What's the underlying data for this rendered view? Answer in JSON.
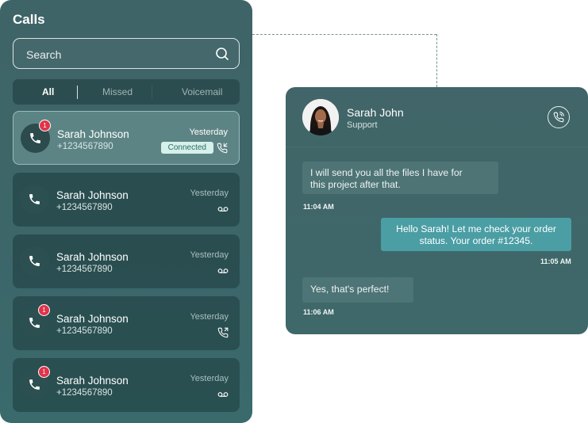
{
  "calls": {
    "title": "Calls",
    "search_placeholder": "Search",
    "tabs": [
      "All",
      "Missed",
      "Voicemail"
    ],
    "active_tab": "All",
    "items": [
      {
        "name": "Sarah Johnson",
        "number": "+1234567890",
        "time": "Yesterday",
        "badge": "1",
        "status": "Connected",
        "status_icon": "phone-incoming-icon",
        "selected": true
      },
      {
        "name": "Sarah Johnson",
        "number": "+1234567890",
        "time": "Yesterday",
        "badge": "",
        "status": "",
        "status_icon": "voicemail-icon",
        "selected": false
      },
      {
        "name": "Sarah Johnson",
        "number": "+1234567890",
        "time": "Yesterday",
        "badge": "",
        "status": "",
        "status_icon": "voicemail-icon",
        "selected": false
      },
      {
        "name": "Sarah Johnson",
        "number": "+1234567890",
        "time": "Yesterday",
        "badge": "1",
        "status": "",
        "status_icon": "phone-outgoing-icon",
        "selected": false
      },
      {
        "name": "Sarah Johnson",
        "number": "+1234567890",
        "time": "Yesterday",
        "badge": "1",
        "status": "",
        "status_icon": "voicemail-icon",
        "selected": false
      }
    ]
  },
  "chat": {
    "contact_name": "Sarah John",
    "contact_role": "Support",
    "messages": [
      {
        "direction": "in",
        "text_line1": "I will send you all the files I have for",
        "text_line2": "this project after that.",
        "time": "11:04 AM"
      },
      {
        "direction": "out",
        "text_line1": "Hello Sarah! Let me check your order",
        "text_line2": "status. Your order #12345.",
        "time": "11:05 AM"
      },
      {
        "direction": "in",
        "text_line1": "Yes, that's perfect!",
        "text_line2": "",
        "time": "11:06 AM"
      }
    ]
  },
  "colors": {
    "panel": "#3e666a",
    "accent": "#4a9ea4",
    "badge": "#e0344a",
    "connected_bg": "#d6f0ea"
  }
}
